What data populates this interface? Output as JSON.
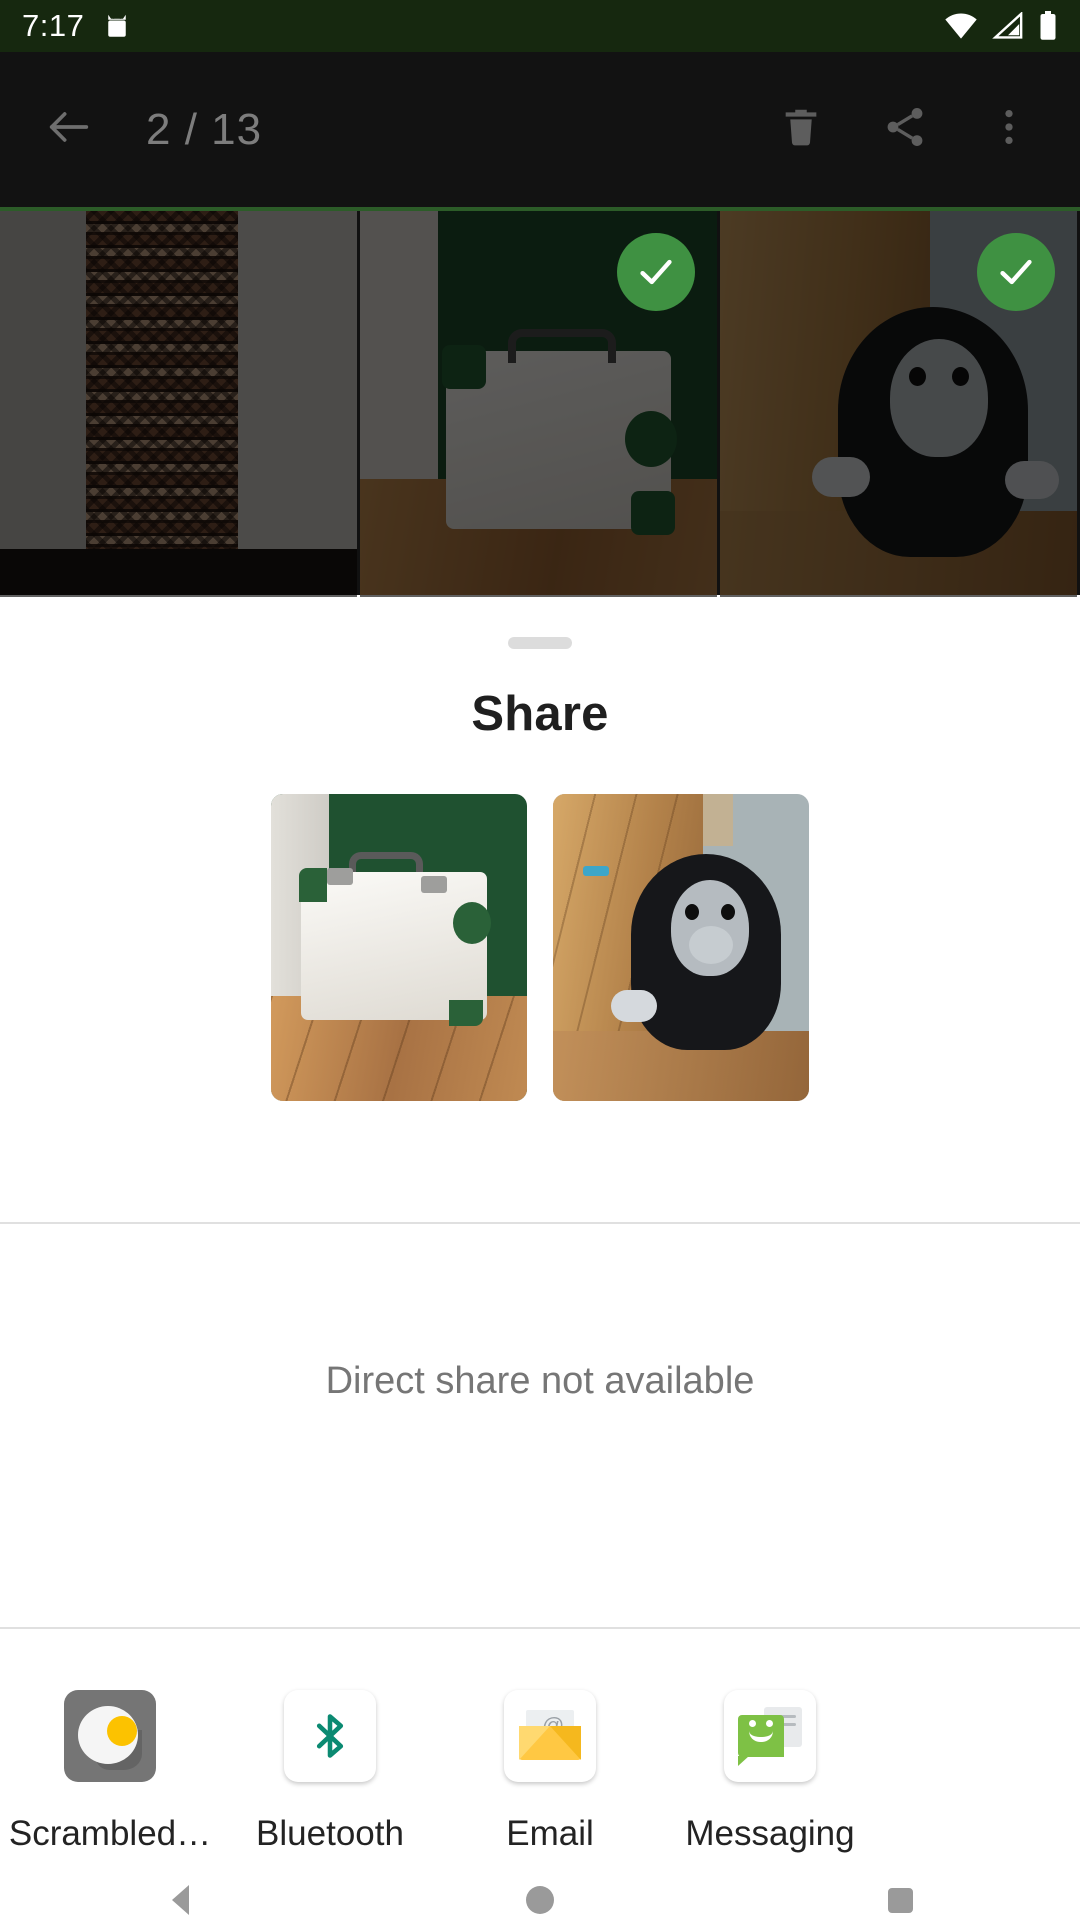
{
  "status_bar": {
    "time": "7:17",
    "notification_icon": "android-robot-icon",
    "icons": [
      "wifi-icon",
      "cellular-signal-icon",
      "battery-icon"
    ],
    "background_color": "#16280f"
  },
  "toolbar": {
    "back_icon": "back-arrow-icon",
    "counter": "2 / 13",
    "delete_icon": "trash-icon",
    "share_icon": "share-icon",
    "overflow_icon": "more-vert-icon",
    "background_color": "#121212"
  },
  "photo_grid": {
    "accent_line_color": "#2c5c28",
    "items": [
      {
        "alt": "patterned-textile-rug",
        "selected": false
      },
      {
        "alt": "white-suitcase-green-corners",
        "selected": true
      },
      {
        "alt": "black-plush-gorilla-toy",
        "selected": true
      }
    ],
    "check_badge_color": "#3f9142"
  },
  "share_sheet": {
    "handle": "drag-handle",
    "title": "Share",
    "previews": [
      {
        "alt": "white-suitcase-green-corners"
      },
      {
        "alt": "black-plush-gorilla-toy"
      }
    ],
    "empty_state": "Direct share not available",
    "apps": [
      {
        "label": "Scrambled…",
        "icon": "scrambled-exif-icon",
        "color": "#757575"
      },
      {
        "label": "Bluetooth",
        "icon": "bluetooth-icon",
        "color": "#0b8a72"
      },
      {
        "label": "Email",
        "icon": "email-envelope-icon",
        "color": "#ffc843"
      },
      {
        "label": "Messaging",
        "icon": "messaging-icon",
        "color": "#7ec145"
      }
    ]
  },
  "nav_bar": {
    "back": "nav-back-icon",
    "home": "nav-home-icon",
    "recents": "nav-recents-icon"
  }
}
